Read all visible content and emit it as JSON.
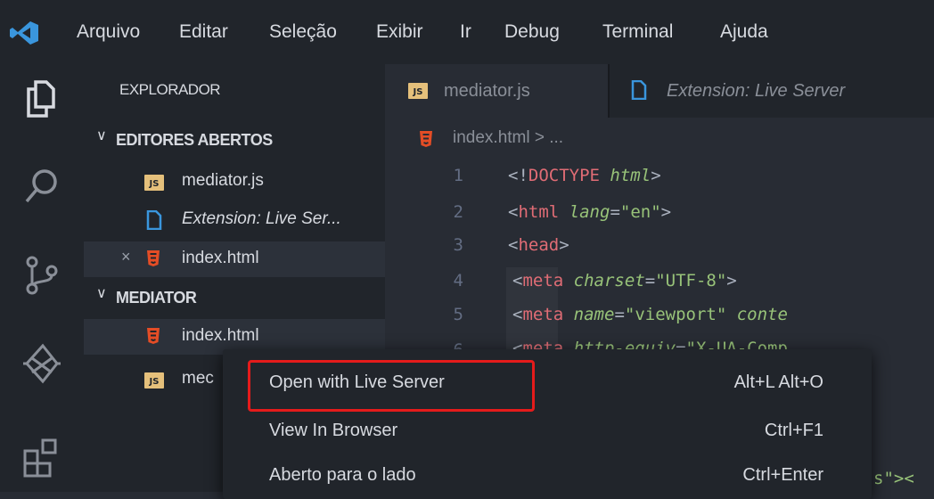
{
  "menu": [
    "Arquivo",
    "Editar",
    "Seleção",
    "Exibir",
    "Ir",
    "Debug",
    "Terminal",
    "Ajuda"
  ],
  "sidebar": {
    "title": "EXPLORADOR",
    "open_editors_header": "EDITORES ABERTOS",
    "open_editors": [
      {
        "label": "mediator.js",
        "icon": "js-file-icon"
      },
      {
        "label": "Extension: Live Ser...",
        "icon": "document-icon"
      },
      {
        "label": "index.html",
        "icon": "html-file-icon"
      }
    ],
    "project_header": "MEDIATOR",
    "project_files": [
      {
        "label": "index.html",
        "icon": "html-file-icon"
      },
      {
        "label": "mec",
        "icon": "js-file-icon"
      }
    ]
  },
  "tabs": [
    {
      "label": "mediator.js",
      "icon": "js-file-icon"
    },
    {
      "label": "Extension: Live Server",
      "icon": "document-icon"
    }
  ],
  "breadcrumb": "index.html > ...",
  "code": {
    "line_numbers": [
      "1",
      "2",
      "3",
      "4",
      "5",
      "6"
    ],
    "lines": [
      "<!DOCTYPE html>",
      "<html lang=\"en\">",
      "<head>",
      "    <meta charset=\"UTF-8\">",
      "    <meta name=\"viewport\" conte",
      "    <meta http-equiv=\"X-UA-Comp"
    ],
    "trailing_fragment": "s\"><"
  },
  "context_menu": {
    "items": [
      {
        "label": "Open with Live Server",
        "shortcut": "Alt+L Alt+O",
        "highlighted": true
      },
      {
        "label": "View In Browser",
        "shortcut": "Ctrl+F1"
      },
      {
        "label": "Aberto para o lado",
        "shortcut": "Ctrl+Enter"
      }
    ]
  },
  "colors": {
    "background": "#282c34",
    "chrome": "#21252b",
    "highlight_border": "#e51b1b",
    "tag": "#e06c75",
    "attribute": "#98c379",
    "vscode_blue": "#3a96dd"
  }
}
